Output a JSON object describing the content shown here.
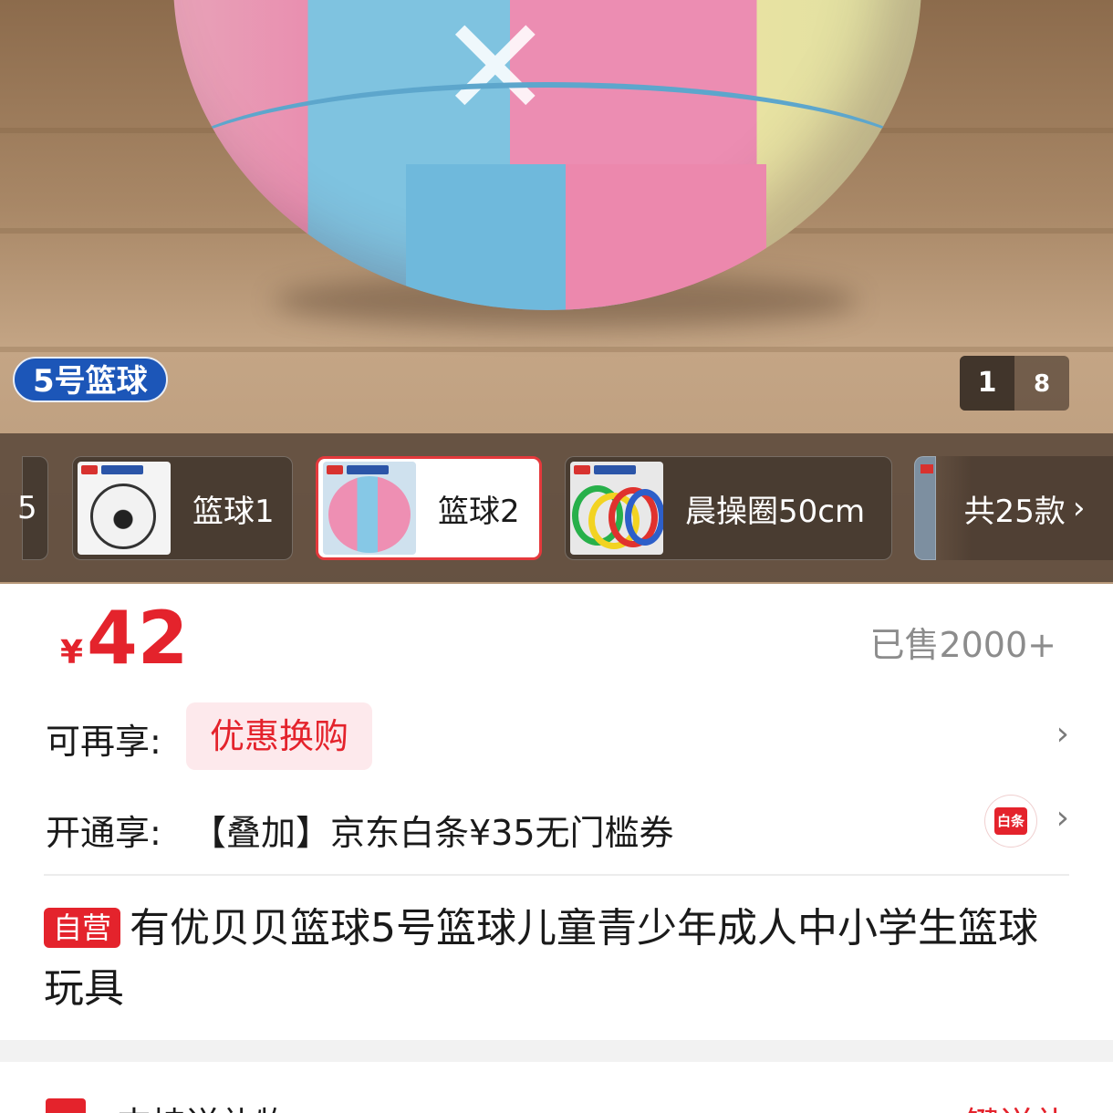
{
  "hero": {
    "image_tag": "5号篮球",
    "image_index": "1",
    "image_total": "8"
  },
  "variants": {
    "items": [
      {
        "label": "篮球1"
      },
      {
        "label": "篮球2",
        "selected": true
      },
      {
        "label": "晨操圈50cm"
      }
    ],
    "more_label": "共25款",
    "partial_left_label": "5"
  },
  "price": {
    "currency": "¥",
    "value": "42",
    "sold": "已售2000+"
  },
  "promos": {
    "row1_label": "可再享:",
    "row1_chip": "优惠换购",
    "row2_label": "开通享:",
    "row2_text": "【叠加】京东白条¥35无门槛券",
    "baitiao_icon_text": "白条"
  },
  "title": {
    "badge": "自营",
    "text": "有优贝贝篮球5号篮球儿童青少年成人中小学生篮球玩具"
  },
  "gift": {
    "label": "支持送礼物",
    "action": "一键送礼"
  },
  "colors": {
    "accent_red": "#e4232c",
    "badge_blue": "#1c56b8"
  }
}
